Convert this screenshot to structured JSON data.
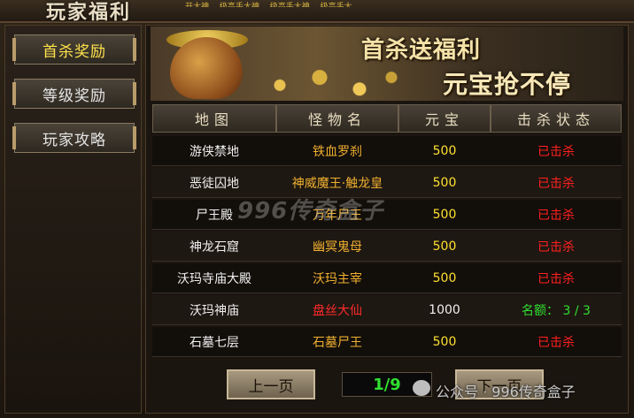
{
  "window": {
    "title": "玩家福利",
    "ticker": "…开大神 …级高手大神 …级高手大神 …级高手大…"
  },
  "sidebar": {
    "items": [
      {
        "label": "首杀奖励",
        "active": true
      },
      {
        "label": "等级奖励",
        "active": false
      },
      {
        "label": "玩家攻略",
        "active": false
      }
    ]
  },
  "banner": {
    "line1": "首杀送福利",
    "line2": "元宝抢不停"
  },
  "table": {
    "headers": [
      "地图",
      "怪物名",
      "元宝",
      "击杀状态"
    ],
    "rows": [
      {
        "map": "游侠禁地",
        "monster": "铁血罗刹",
        "yuanbao": "500",
        "status": "已击杀"
      },
      {
        "map": "恶徒囚地",
        "monster": "神威魔王·触龙皇",
        "yuanbao": "500",
        "status": "已击杀"
      },
      {
        "map": "尸王殿",
        "monster": "万年尸王",
        "yuanbao": "500",
        "status": "已击杀"
      },
      {
        "map": "神龙石窟",
        "monster": "幽冥鬼母",
        "yuanbao": "500",
        "status": "已击杀"
      },
      {
        "map": "沃玛寺庙大殿",
        "monster": "沃玛主宰",
        "yuanbao": "500",
        "status": "已击杀"
      },
      {
        "map": "沃玛神庙",
        "monster": "盘丝大仙",
        "yuanbao": "1000",
        "status": "名额： 3 / 3"
      },
      {
        "map": "石墓七层",
        "monster": "石墓尸王",
        "yuanbao": "500",
        "status": "已击杀"
      }
    ]
  },
  "pagination": {
    "prev": "上一页",
    "page": "1/9",
    "next": "下一页"
  },
  "overlay": {
    "watermark": "996传奇盒子",
    "footer": "公众号 · 996传奇盒子"
  },
  "colors": {
    "active_tab": "#ffe24a",
    "killed": "#ff2020",
    "quota": "#30e030",
    "highlight_monster": "#ff2a2a"
  }
}
